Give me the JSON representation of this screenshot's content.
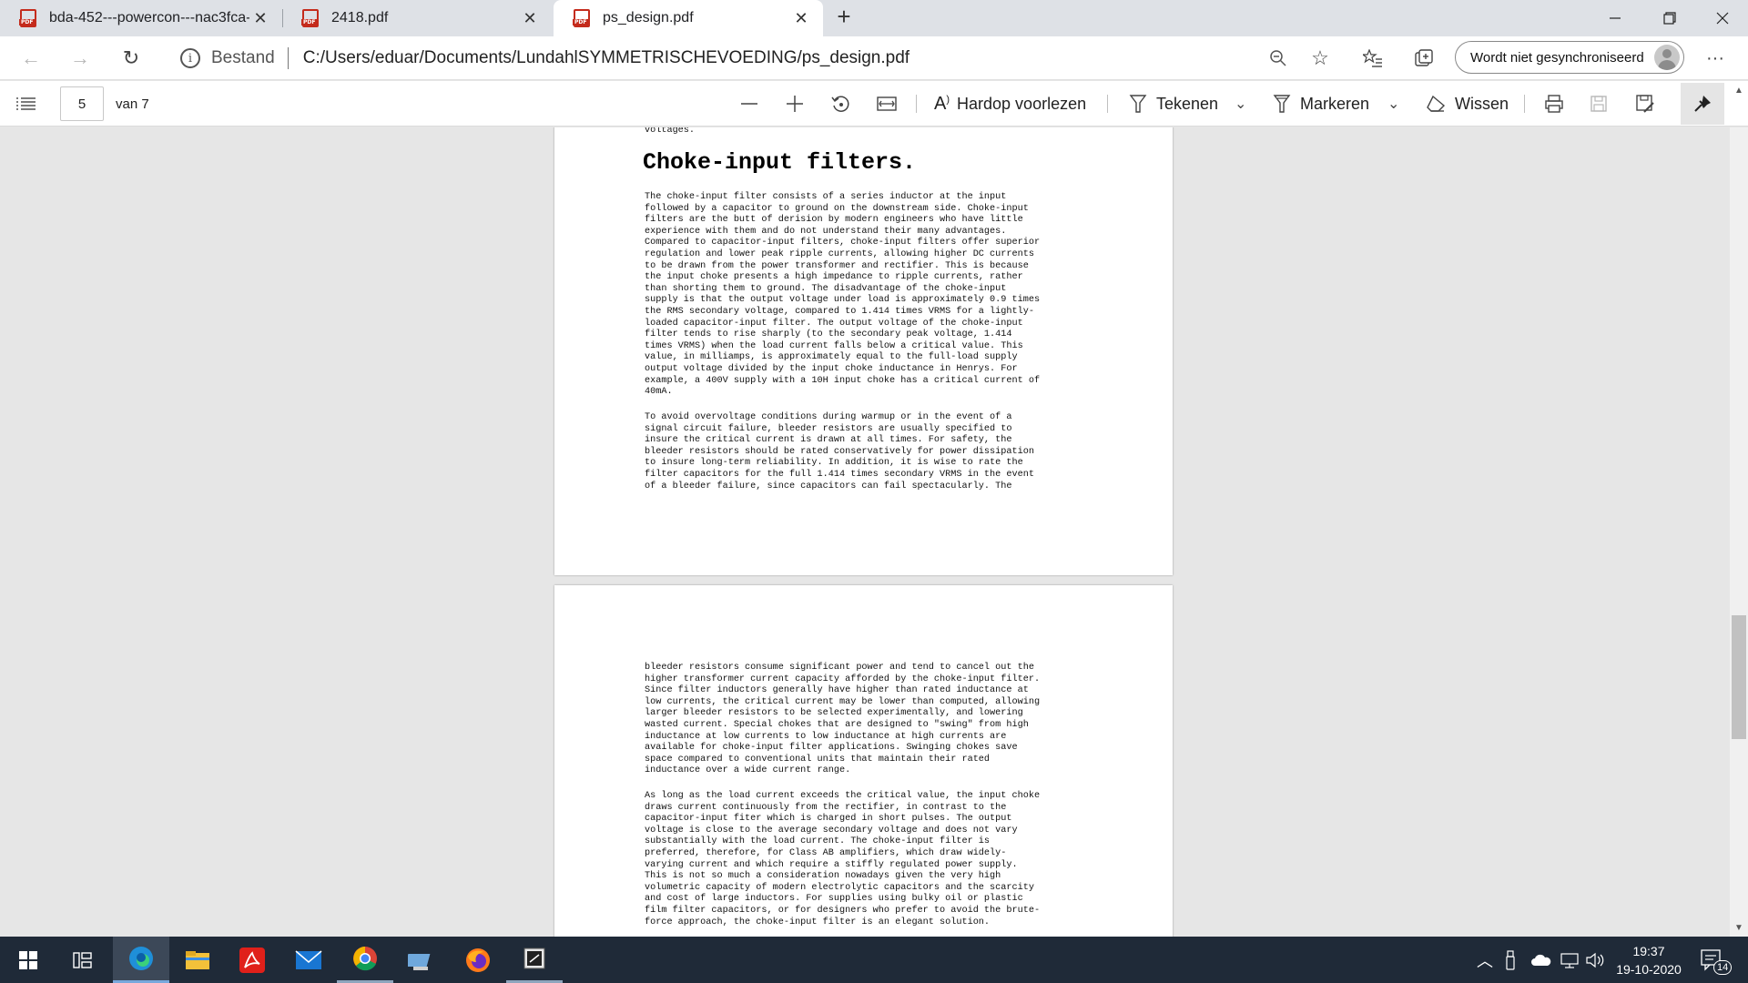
{
  "tabs": [
    {
      "title": "bda-452---powercon---nac3fca-",
      "active": false
    },
    {
      "title": "2418.pdf",
      "active": false
    },
    {
      "title": "ps_design.pdf",
      "active": true
    }
  ],
  "address": {
    "security_label": "Bestand",
    "url": "C:/Users/eduar/Documents/LundahlSYMMETRISCHEVOEDING/ps_design.pdf"
  },
  "profile": {
    "sync_label": "Wordt niet gesynchroniseerd"
  },
  "pdf_toolbar": {
    "page_number": "5",
    "page_total_label": "van 7",
    "read_aloud": "Hardop voorlezen",
    "draw": "Tekenen",
    "highlight": "Markeren",
    "erase": "Wissen"
  },
  "document": {
    "page1_top_fragment": "voltages.",
    "page1_heading": "Choke-input filters.",
    "page1_para1": [
      "The choke-input filter consists of a series inductor at the input",
      "followed by a capacitor to ground on the downstream side. Choke-input",
      "filters are the butt of derision by modern engineers who have little",
      "experience with them and do not understand their many advantages.",
      "Compared to capacitor-input filters, choke-input filters offer superior",
      "regulation and lower peak ripple currents, allowing higher DC currents",
      "to be drawn from the power transformer and rectifier. This is because",
      "the input choke presents a high impedance to ripple currents, rather",
      "than shorting them to ground. The disadvantage of the choke-input",
      "supply is that the output voltage under load is approximately 0.9 times",
      "the RMS secondary voltage, compared to 1.414 times VRMS for a lightly-",
      "loaded capacitor-input filter. The output voltage of the choke-input",
      "filter tends to rise sharply (to the secondary peak voltage, 1.414",
      "times VRMS) when the load current falls below a critical value. This",
      "value, in milliamps, is approximately equal to the full-load supply",
      "output voltage divided by the input choke inductance in Henrys. For",
      "example, a 400V supply with a 10H input choke has a critical current of",
      "40mA."
    ],
    "page1_para2": [
      "To avoid overvoltage conditions during warmup or in the event of a",
      "signal circuit failure, bleeder resistors are usually specified to",
      "insure the critical current is drawn at all times. For safety, the",
      "bleeder resistors should be rated conservatively for power dissipation",
      "to insure long-term reliability. In addition, it is wise to rate the",
      "filter capacitors for the full 1.414 times secondary VRMS in the event",
      "of a bleeder failure, since capacitors can fail spectacularly. The"
    ],
    "page2_para1": [
      "bleeder resistors consume significant power and tend to cancel out the",
      "higher transformer current capacity afforded by the choke-input filter.",
      "Since filter inductors generally have higher than rated inductance at",
      "low currents, the critical current may be lower than computed, allowing",
      "larger bleeder resistors to be selected experimentally, and lowering",
      "wasted current. Special chokes that are designed to \"swing\" from high",
      "inductance at low currents to low inductance at high currents are",
      "available for choke-input filter applications. Swinging chokes save",
      "space compared to conventional units that maintain their rated",
      "inductance over a wide current range."
    ],
    "page2_para2": [
      "As long as the load current exceeds the critical value, the input choke",
      "draws current continuously from the rectifier, in contrast to the",
      "capacitor-input fiter which is charged in short pulses. The output",
      "voltage is close to the average secondary voltage and does not vary",
      "substantially with the load current. The choke-input filter is",
      "preferred, therefore, for Class AB amplifiers, which draw widely-",
      "varying current and which require a stiffly regulated power supply.",
      "This is not so much a consideration nowadays given the very high",
      "volumetric capacity of modern electrolytic capacitors and the scarcity",
      "and cost of large inductors. For supplies using bulky oil or plastic",
      "film filter capacitors, or for designers who prefer to avoid the brute-",
      "force approach, the choke-input filter is an elegant solution."
    ]
  },
  "taskbar": {
    "time": "19:37",
    "date": "19-10-2020",
    "notification_count": "14"
  },
  "colors": {
    "tab_strip": "#dee1e6",
    "pdf_icon": "#c42b1c",
    "taskbar": "#1f2a38",
    "doc_background": "#e6e6e6"
  }
}
